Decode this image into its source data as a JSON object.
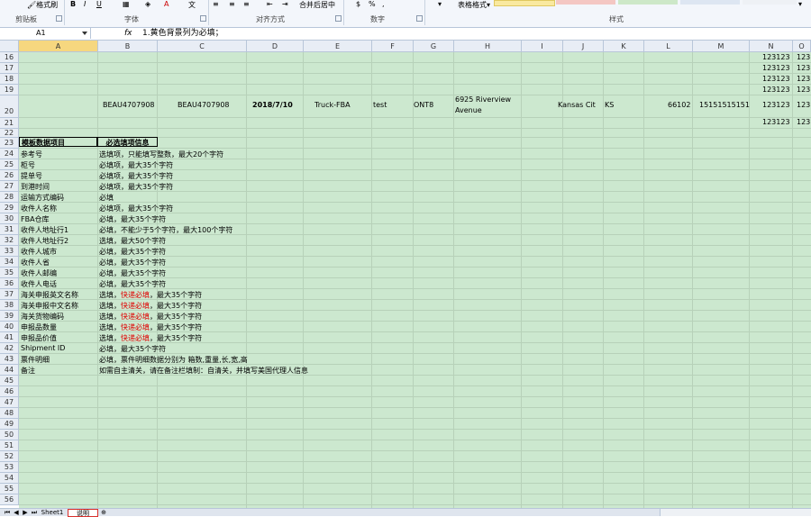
{
  "ribbon": {
    "format_painter": "格式刷",
    "table_format": "表格格式",
    "groups": [
      "剪贴板",
      "字体",
      "对齐方式",
      "数字",
      "样式"
    ],
    "merge_center": "合并后居中",
    "bold": "B",
    "italic": "I",
    "underline": "U",
    "percent": "%"
  },
  "formula_bar": {
    "name_box": "A1",
    "fx": "fx",
    "value": "1.黄色背景列为必填；"
  },
  "columns": [
    "A",
    "B",
    "C",
    "D",
    "E",
    "F",
    "G",
    "H",
    "I",
    "J",
    "K",
    "L",
    "M",
    "N",
    "O"
  ],
  "rows": {
    "r20": {
      "B": "BEAU4707908",
      "C": "BEAU4707908",
      "D": "2018/7/10",
      "E": "Truck-FBA",
      "F": "test",
      "G": "ONT8",
      "H1": "6925 Riverview",
      "H2": "Avenue",
      "I": "Kansas Cit",
      "K": "KS",
      "L": "66102",
      "M": "15151515151"
    },
    "n_value": "123123",
    "n_partial": "123",
    "header_a": "模板数据项目",
    "header_b": "必选填项信息"
  },
  "items": [
    {
      "row": "24",
      "name": "参考号",
      "pre": "选填项，只能填写整数，最大20个字符",
      "red": "",
      "post": ""
    },
    {
      "row": "25",
      "name": "柜号",
      "pre": "必填项，最大35个字符",
      "red": "",
      "post": ""
    },
    {
      "row": "26",
      "name": "提单号",
      "pre": "必填项，最大35个字符",
      "red": "",
      "post": ""
    },
    {
      "row": "27",
      "name": "到港时间",
      "pre": "必填项，最大35个字符",
      "red": "",
      "post": ""
    },
    {
      "row": "28",
      "name": "运输方式编码",
      "pre": "必填",
      "red": "",
      "post": ""
    },
    {
      "row": "29",
      "name": "收件人名称",
      "pre": "必填项，最大35个字符",
      "red": "",
      "post": ""
    },
    {
      "row": "30",
      "name": "FBA仓库",
      "pre": "必填，最大35个字符",
      "red": "",
      "post": ""
    },
    {
      "row": "31",
      "name": "收件人地址行1",
      "pre": "必填，不能少于5个字符，最大100个字符",
      "red": "",
      "post": ""
    },
    {
      "row": "32",
      "name": "收件人地址行2",
      "pre": "选填，最大50个字符",
      "red": "",
      "post": ""
    },
    {
      "row": "33",
      "name": "收件人城市",
      "pre": "必填，最大35个字符",
      "red": "",
      "post": ""
    },
    {
      "row": "34",
      "name": "收件人省",
      "pre": "必填，最大35个字符",
      "red": "",
      "post": ""
    },
    {
      "row": "35",
      "name": "收件人邮编",
      "pre": "必填，最大35个字符",
      "red": "",
      "post": ""
    },
    {
      "row": "36",
      "name": "收件人电话",
      "pre": "必填，最大35个字符",
      "red": "",
      "post": ""
    },
    {
      "row": "37",
      "name": "海关申报英文名称",
      "pre": "选填，",
      "red": "快递必填",
      "post": "，最大35个字符"
    },
    {
      "row": "38",
      "name": "海关申报中文名称",
      "pre": "选填，",
      "red": "快递必填",
      "post": "，最大35个字符"
    },
    {
      "row": "39",
      "name": "海关货物编码",
      "pre": "选填，",
      "red": "快递必填",
      "post": "，最大35个字符"
    },
    {
      "row": "40",
      "name": "申报品数量",
      "pre": "选填，",
      "red": "快递必填",
      "post": "，最大35个字符"
    },
    {
      "row": "41",
      "name": "申报品价值",
      "pre": "选填，",
      "red": "快递必填",
      "post": "，最大35个字符"
    },
    {
      "row": "42",
      "name": "Shipment ID",
      "pre": "必填，最大35个字符",
      "red": "",
      "post": ""
    },
    {
      "row": "43",
      "name": "票件明细",
      "pre": "必填，票件明细数据分别为 箱数,重量,长,宽,高",
      "red": "",
      "post": ""
    },
    {
      "row": "44",
      "name": "备注",
      "pre": "如需自主清关，请在备注栏填制：自清关，并填写美国代理人信息",
      "red": "",
      "post": ""
    }
  ],
  "sheet_tabs": [
    "Sheet1",
    "说明"
  ],
  "colors": {
    "grid_bg": "#cce8cf",
    "header_bg": "#e8edf5",
    "accent_tab_border": "#d9302c",
    "red_text": "#e00000"
  }
}
